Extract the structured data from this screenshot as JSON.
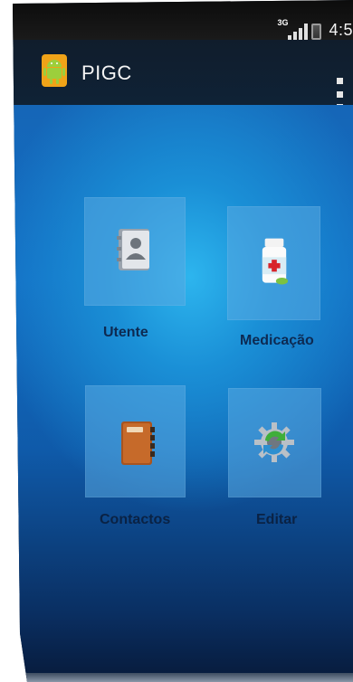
{
  "status_bar": {
    "network": "3G",
    "time": "4:5"
  },
  "action_bar": {
    "title": "PIGC",
    "app_icon": "android-icon",
    "overflow_icon": "overflow-menu-icon"
  },
  "tiles": [
    {
      "label": "Utente",
      "icon": "contact-card-icon"
    },
    {
      "label": "Medicação",
      "icon": "medicine-bottle-icon"
    },
    {
      "label": "Contactos",
      "icon": "address-book-icon"
    },
    {
      "label": "Editar",
      "icon": "gear-refresh-icon"
    }
  ],
  "colors": {
    "screen_blue": "#1a8fd6",
    "tile": "#5aaae1",
    "label": "#0d2a52"
  }
}
